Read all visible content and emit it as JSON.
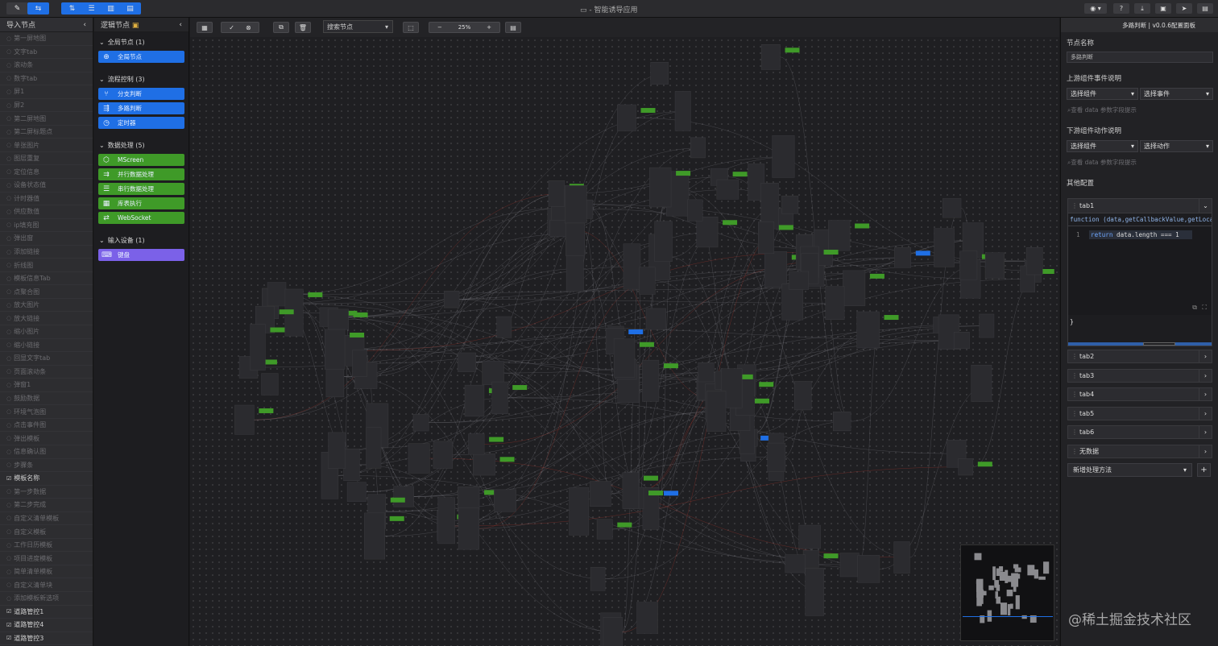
{
  "window": {
    "title": "智能诱导应用"
  },
  "left_panel": {
    "title": "导入节点",
    "items": [
      {
        "label": "第一屏地图",
        "active": false
      },
      {
        "label": "文字tab",
        "active": false
      },
      {
        "label": "滚动条",
        "active": false
      },
      {
        "label": "数字tab",
        "active": false
      },
      {
        "label": "屏1",
        "active": false
      },
      {
        "label": "屏2",
        "active": false
      },
      {
        "label": "第二屏地图",
        "active": false
      },
      {
        "label": "第二屏标题点",
        "active": false
      },
      {
        "label": "单张图片",
        "active": false
      },
      {
        "label": "图层重复",
        "active": false
      },
      {
        "label": "定位信息",
        "active": false
      },
      {
        "label": "设备状态值",
        "active": false
      },
      {
        "label": "计时器值",
        "active": false
      },
      {
        "label": "供应数值",
        "active": false
      },
      {
        "label": "ip填充图",
        "active": false
      },
      {
        "label": "弹出窗",
        "active": false
      },
      {
        "label": "添加链接",
        "active": false
      },
      {
        "label": "折线图",
        "active": false
      },
      {
        "label": "模板信息Tab",
        "active": false
      },
      {
        "label": "点聚合图",
        "active": false
      },
      {
        "label": "放大图片",
        "active": false
      },
      {
        "label": "放大链接",
        "active": false
      },
      {
        "label": "缩小图片",
        "active": false
      },
      {
        "label": "缩小链接",
        "active": false
      },
      {
        "label": "回显文字tab",
        "active": false
      },
      {
        "label": "页面滚动条",
        "active": false
      },
      {
        "label": "弹窗1",
        "active": false
      },
      {
        "label": "鼓励数据",
        "active": false
      },
      {
        "label": "环境气泡图",
        "active": false
      },
      {
        "label": "点击事件图",
        "active": false
      },
      {
        "label": "弹出模板",
        "active": false
      },
      {
        "label": "信息确认图",
        "active": false
      },
      {
        "label": "步骤条",
        "active": false
      },
      {
        "label": "模板名称",
        "active": true
      },
      {
        "label": "第一步数据",
        "active": false
      },
      {
        "label": "第二步完成",
        "active": false
      },
      {
        "label": "自定义清单模板",
        "active": false
      },
      {
        "label": "自定义模板",
        "active": false
      },
      {
        "label": "工作日历模板",
        "active": false
      },
      {
        "label": "项目进度模板",
        "active": false
      },
      {
        "label": "简单清单模板",
        "active": false
      },
      {
        "label": "自定义清单块",
        "active": false
      },
      {
        "label": "添加模板新选项",
        "active": false
      },
      {
        "label": "道路管控1",
        "active": true
      },
      {
        "label": "道路管控4",
        "active": true
      },
      {
        "label": "道路管控3",
        "active": true
      }
    ]
  },
  "logic_panel": {
    "title": "逻辑节点",
    "groups": [
      {
        "label": "全局节点 (1)",
        "nodes": [
          {
            "label": "全局节点",
            "color": "blue",
            "icon": "globe-icon",
            "glyph": "⊕"
          }
        ]
      },
      {
        "label": "流程控制 (3)",
        "nodes": [
          {
            "label": "分支判断",
            "color": "blue",
            "icon": "branch-icon",
            "glyph": "⑂"
          },
          {
            "label": "多路判断",
            "color": "blue",
            "icon": "multi-branch-icon",
            "glyph": "⇶"
          },
          {
            "label": "定时器",
            "color": "blue",
            "icon": "clock-icon",
            "glyph": "◷"
          }
        ]
      },
      {
        "label": "数据处理 (5)",
        "nodes": [
          {
            "label": "MScreen",
            "color": "green",
            "icon": "cube-icon",
            "glyph": "⬡"
          },
          {
            "label": "并行数据处理",
            "color": "green",
            "icon": "parallel-icon",
            "glyph": "⇉"
          },
          {
            "label": "串行数据处理",
            "color": "green",
            "icon": "serial-icon",
            "glyph": "☰"
          },
          {
            "label": "库表执行",
            "color": "green",
            "icon": "table-icon",
            "glyph": "▦"
          },
          {
            "label": "WebSocket",
            "color": "green",
            "icon": "link-icon",
            "glyph": "⇄"
          }
        ]
      },
      {
        "label": "输入设备 (1)",
        "nodes": [
          {
            "label": "键盘",
            "color": "purple",
            "icon": "keyboard-icon",
            "glyph": "⌨"
          }
        ]
      }
    ]
  },
  "canvas_toolbar": {
    "search_placeholder": "搜索节点",
    "zoom": "25",
    "zoom_unit": "%"
  },
  "right_panel": {
    "header": "多路判断 | v0.0.6配置面板",
    "node_name_label": "节点名称",
    "node_name_value": "多路判断",
    "upstream_label": "上游组件事件说明",
    "upstream_component": "选择组件",
    "upstream_event": "选择事件",
    "upstream_hint": "查看 data 参数字段提示",
    "downstream_label": "下游组件动作说明",
    "downstream_component": "选择组件",
    "downstream_action": "选择动作",
    "downstream_hint": "查看 data 参数字段提示",
    "other_label": "其他配置",
    "active_tab": "tab1",
    "code_signature": "function (data,getCallbackValue,getLocalV",
    "code_line_no": "1",
    "code_keyword": "return",
    "code_body": "data.length === 1",
    "code_close": "}",
    "tabs": [
      "tab2",
      "tab3",
      "tab4",
      "tab5",
      "tab6",
      "无数据"
    ],
    "add_method": "新增处理方法",
    "add_button": "+"
  },
  "watermark": "@稀土掘金技术社区",
  "colors": {
    "accent_blue": "#1f6fe5",
    "green": "#3f9a28",
    "purple": "#7b61e8",
    "bg": "#1f1f22"
  }
}
